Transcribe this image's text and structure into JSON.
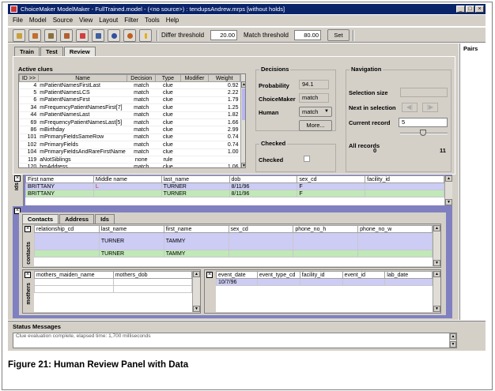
{
  "window": {
    "title": "ChoiceMaker ModelMaker - FullTrained.model - (<no source>) : tendupsAndrew.mrps [without holds]",
    "min": "_",
    "max": "□",
    "close": "×"
  },
  "menu": [
    "File",
    "Model",
    "Source",
    "View",
    "Layout",
    "Filter",
    "Tools",
    "Help"
  ],
  "toolbar": {
    "differ_label": "Differ threshold",
    "differ_value": "20.00",
    "match_label": "Match threshold",
    "match_value": "80.00",
    "set_label": "Set"
  },
  "tabs": [
    "Train",
    "Test",
    "Review"
  ],
  "pairs_label": "Pairs",
  "clues": {
    "title": "Active clues",
    "headers": [
      "ID >>",
      "Name",
      "Decision",
      "Type",
      "Modifier",
      "Weight"
    ],
    "rows": [
      [
        "4",
        "mPatientNamesFirstLast",
        "match",
        "clue",
        "",
        "0.92"
      ],
      [
        "5",
        "mPatientNamesLCS",
        "match",
        "clue",
        "",
        "2.22"
      ],
      [
        "6",
        "mPatientNamesFirst",
        "match",
        "clue",
        "",
        "1.79"
      ],
      [
        "34",
        "mFrequencyPatientNamesFirst[7]",
        "match",
        "clue",
        "",
        "1.25"
      ],
      [
        "44",
        "mPatientNamesLast",
        "match",
        "clue",
        "",
        "1.82"
      ],
      [
        "69",
        "mFrequencyPatientNamesLast[5]",
        "match",
        "clue",
        "",
        "1.66"
      ],
      [
        "86",
        "mBirthday",
        "match",
        "clue",
        "",
        "2.99"
      ],
      [
        "101",
        "mPrimaryFieldsSameRow",
        "match",
        "clue",
        "",
        "0.74"
      ],
      [
        "102",
        "mPrimaryFields",
        "match",
        "clue",
        "",
        "0.74"
      ],
      [
        "104",
        "mPrimaryFieldsAndRareFirstName",
        "match",
        "clue",
        "",
        "1.00"
      ],
      [
        "119",
        "aNotSiblings",
        "none",
        "rule",
        "",
        ""
      ],
      [
        "120",
        "hmAddress",
        "match",
        "clue",
        "",
        "1.06"
      ]
    ]
  },
  "decisions": {
    "title": "Decisions",
    "probability_label": "Probability",
    "probability": "94.1",
    "cm_label": "ChoiceMaker",
    "cm": "match",
    "human_label": "Human",
    "human": "match",
    "more": "More..."
  },
  "checked": {
    "title": "Checked",
    "label": "Checked"
  },
  "navigation": {
    "title": "Navigation",
    "selection_size": "Selection size",
    "next_label": "Next in selection",
    "current_label": "Current record",
    "current": "5",
    "all_label": "All records",
    "min": "0",
    "max": "11",
    "slider_value": 0.45
  },
  "record": {
    "label": "ids",
    "headers": [
      "First name",
      "Middle name",
      "last_name",
      "dob",
      "sex_cd",
      "facility_id"
    ],
    "rows": [
      [
        "BRITTANY",
        "L",
        "TURNER",
        "8/11/96",
        "F",
        ""
      ],
      [
        "BRITTANY",
        "",
        "TURNER",
        "8/11/96",
        "F",
        ""
      ]
    ]
  },
  "subtabs": [
    "Contacts",
    "Address",
    "Ids"
  ],
  "contacts": {
    "label": "contacts",
    "headers": [
      "relationship_cd",
      "last_name",
      "first_name",
      "sex_cd",
      "phone_no_h",
      "phone_no_w"
    ],
    "rows": [
      [
        "",
        "TURNER",
        "TAMMY",
        "",
        "",
        ""
      ],
      [
        "",
        "TURNER",
        "TAMMY",
        "",
        "",
        ""
      ]
    ]
  },
  "mothers": {
    "label": "mothers",
    "headers": [
      "mothers_maiden_name",
      "mothers_dob"
    ]
  },
  "events": {
    "headers": [
      "event_date",
      "event_type_cd",
      "facility_id",
      "event_id",
      "lab_date"
    ],
    "rows": [
      [
        "10/7/96",
        "",
        "",
        "",
        ""
      ]
    ]
  },
  "status": {
    "title": "Status Messages",
    "text": "Clue evaluation complete, elapsed time: 1,700 milliseconds"
  },
  "caption": "Figure 21: Human Review Panel with Data"
}
